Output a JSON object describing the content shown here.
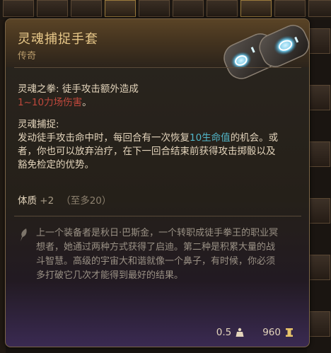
{
  "tooltip": {
    "title": "灵魂捕捉手套",
    "rarity": "传奇",
    "passive1": {
      "name": "灵魂之拳:",
      "text": "徒手攻击额外造成",
      "damage": "1~10力场伤害",
      "end": "。"
    },
    "passive2": {
      "name": "灵魂捕捉:",
      "text_a": "发动徒手攻击命中时，每回合有一次恢复",
      "heal": "10生命值",
      "text_b": "的机会。或者，你也可以放弃治疗，在下一回合结束前获得攻击掷骰以及豁免检定的优势。"
    },
    "stat": {
      "name": "体质",
      "bonus": "+2",
      "cap": "（至多20）"
    },
    "lore": "上一个装备者是秋日·巴斯金，一个转职成徒手拳王的职业冥想者，她通过两种方式获得了启迪。第二种是积累大量的战斗智慧。高级的宇宙大和谐就像一个鼻子，有时候，你必须多打破它几次才能得到最好的结果。",
    "weight": "0.5",
    "price": "960"
  },
  "colors": {
    "title": "#e9c98a",
    "damage": "#c0483c",
    "heal": "#52b7c9"
  },
  "icons": {
    "item": "soul-glove-icon",
    "lore": "quill-icon",
    "weight": "weight-icon",
    "gold": "gold-icon"
  }
}
